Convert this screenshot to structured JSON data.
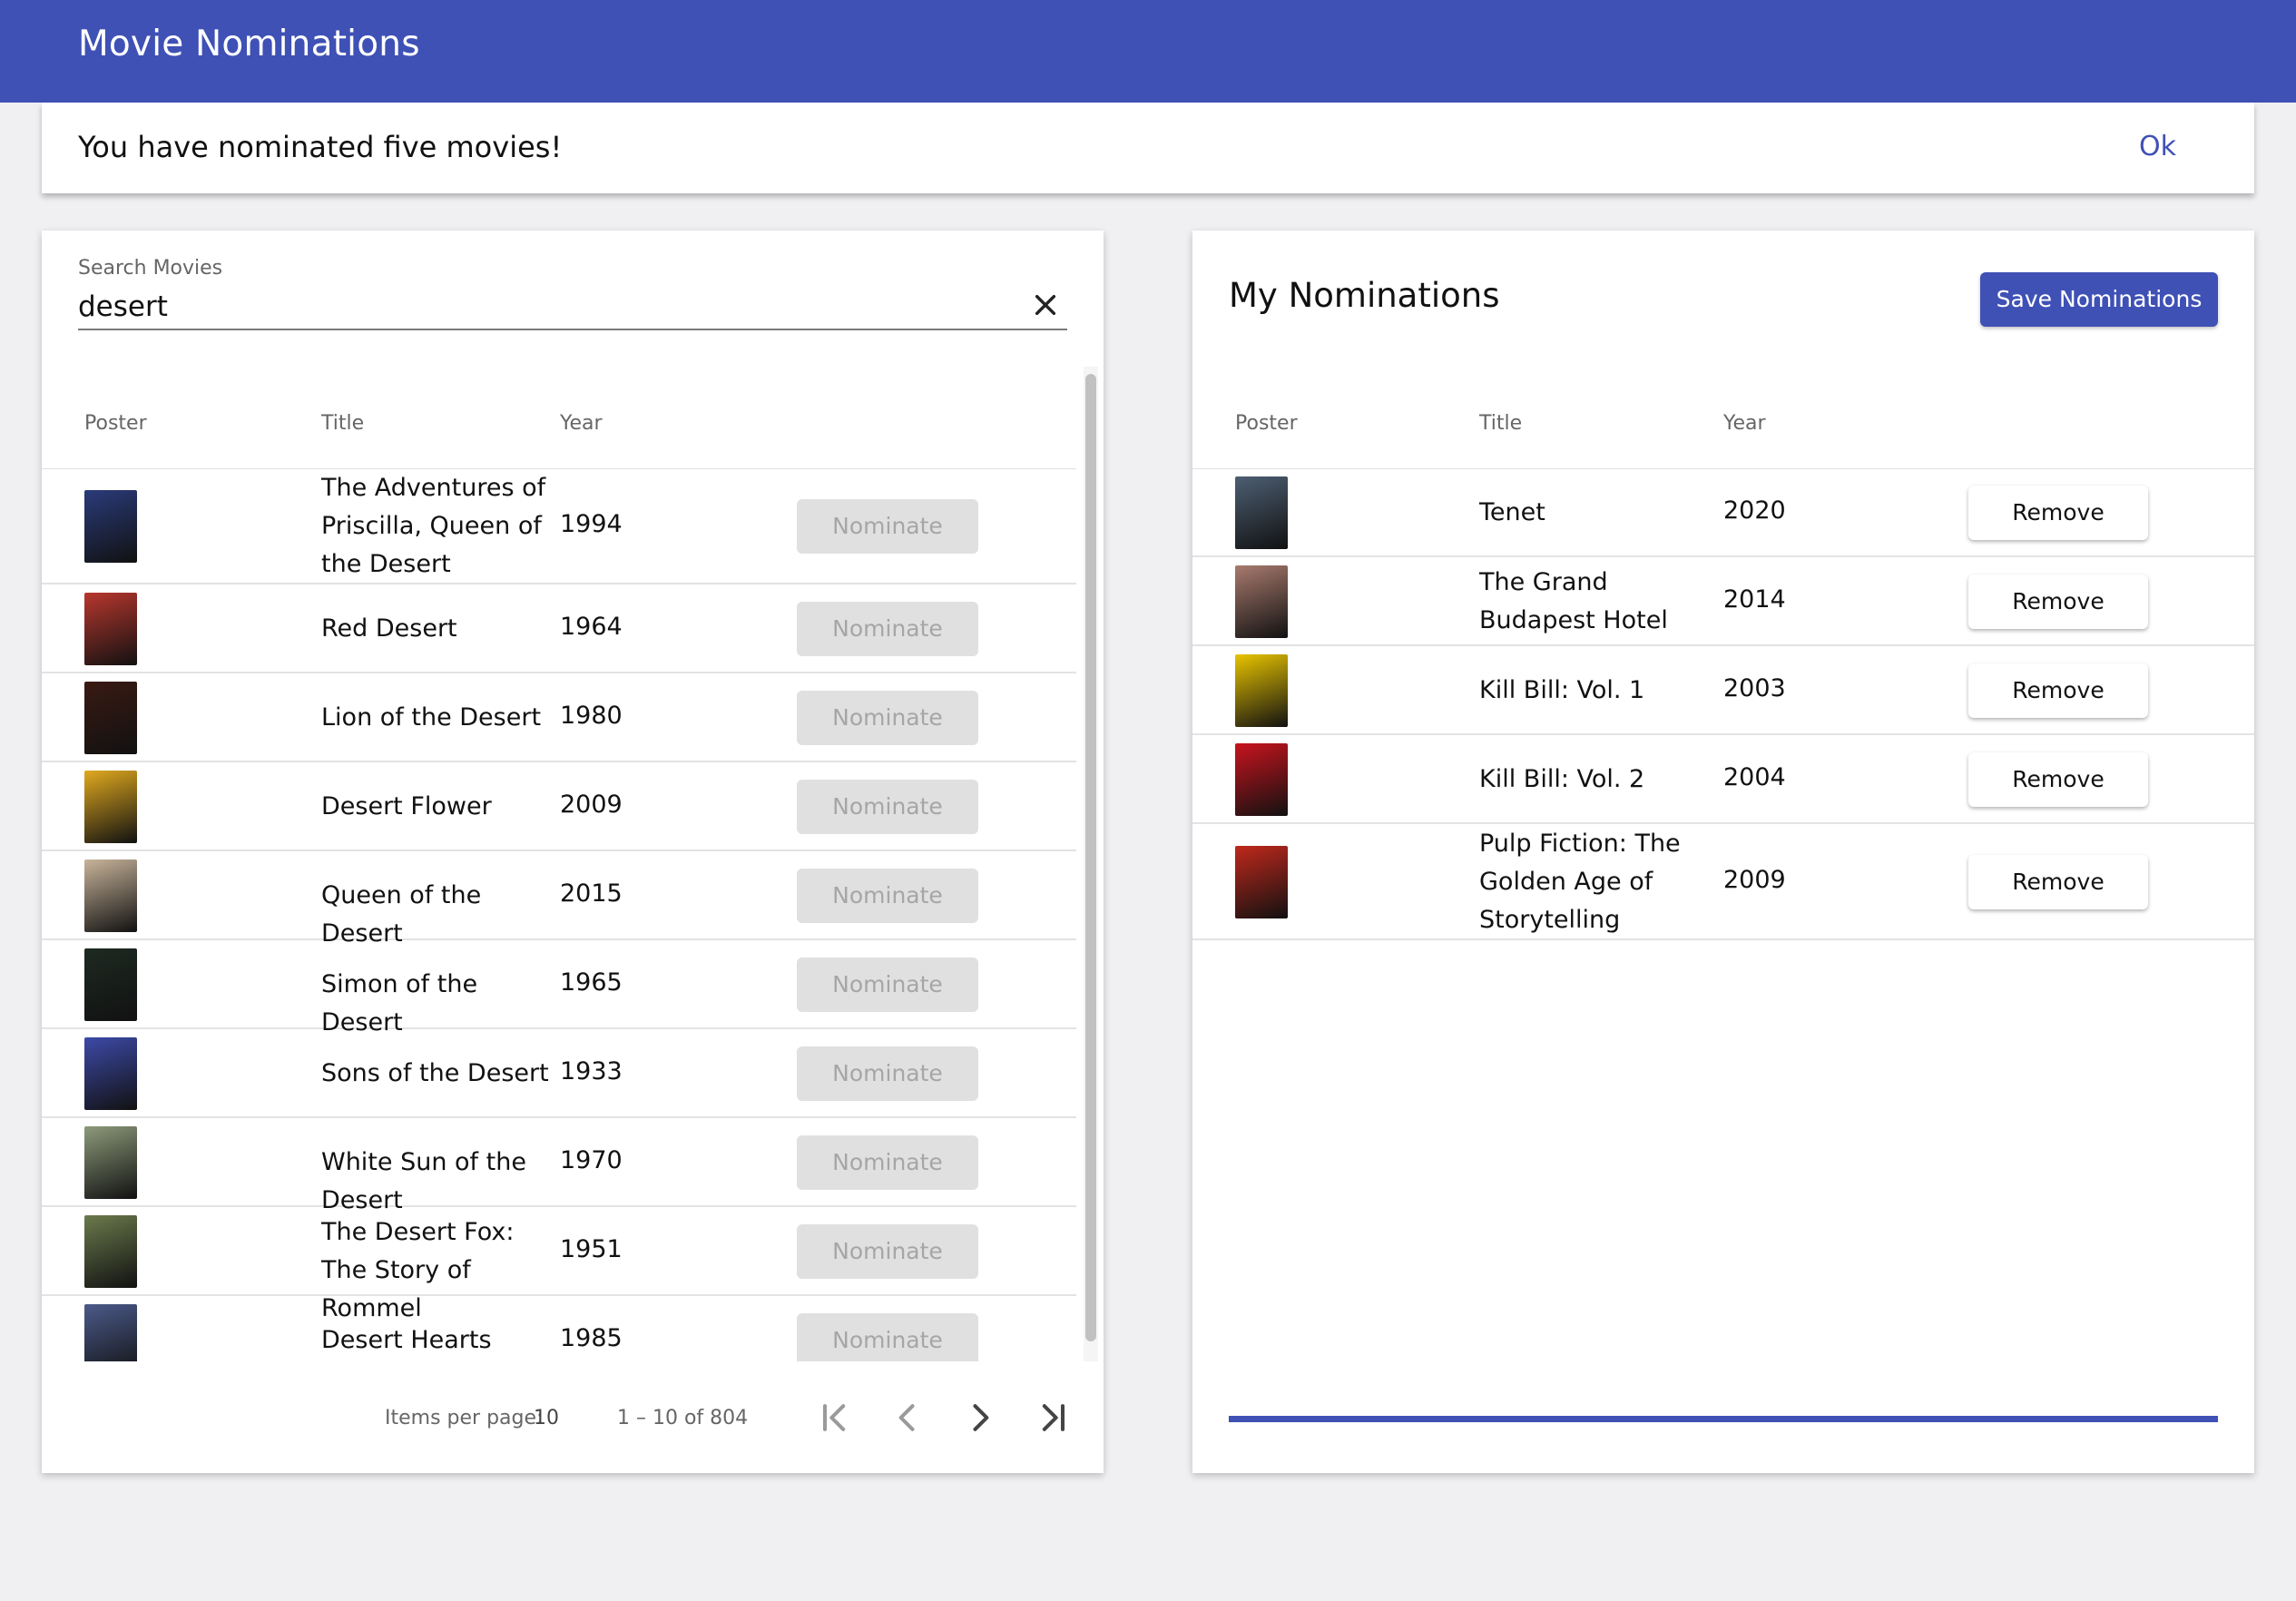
{
  "app": {
    "title": "Movie Nominations"
  },
  "banner": {
    "message": "You have nominated five movies!",
    "ok_label": "Ok"
  },
  "search": {
    "label": "Search Movies",
    "value": "desert"
  },
  "results": {
    "columns": {
      "poster": "Poster",
      "title": "Title",
      "year": "Year"
    },
    "nominate_label": "Nominate",
    "rows": [
      {
        "title": "The Adventures of Priscilla, Queen of the Desert",
        "year": "1994",
        "poster_color": "#2a3b7a"
      },
      {
        "title": "Red Desert",
        "year": "1964",
        "poster_color": "#b8372e"
      },
      {
        "title": "Lion of the Desert",
        "year": "1980",
        "poster_color": "#3a1a12"
      },
      {
        "title": "Desert Flower",
        "year": "2009",
        "poster_color": "#e0a91f"
      },
      {
        "title": "Queen of the Desert",
        "year": "2015",
        "poster_color": "#c8b49a"
      },
      {
        "title": "Simon of the Desert",
        "year": "1965",
        "poster_color": "#1e2a22"
      },
      {
        "title": "Sons of the Desert",
        "year": "1933",
        "poster_color": "#3d4aa8"
      },
      {
        "title": "White Sun of the Desert",
        "year": "1970",
        "poster_color": "#8d9a7a"
      },
      {
        "title": "The Desert Fox: The Story of Rommel",
        "year": "1951",
        "poster_color": "#6b7a4c"
      },
      {
        "title": "Desert Hearts",
        "year": "1985",
        "poster_color": "#4b5a8a"
      }
    ]
  },
  "paginator": {
    "items_per_page_label": "Items per page:",
    "items_per_page": "10",
    "range": "1 – 10 of 804"
  },
  "nominations": {
    "title": "My Nominations",
    "save_label": "Save Nominations",
    "columns": {
      "poster": "Poster",
      "title": "Title",
      "year": "Year"
    },
    "remove_label": "Remove",
    "progress": 1.0,
    "rows": [
      {
        "title": "Tenet",
        "year": "2020",
        "poster_color": "#4d5f73"
      },
      {
        "title": "The Grand Budapest Hotel",
        "year": "2014",
        "poster_color": "#a87a6e"
      },
      {
        "title": "Kill Bill: Vol. 1",
        "year": "2003",
        "poster_color": "#e8c400"
      },
      {
        "title": "Kill Bill: Vol. 2",
        "year": "2004",
        "poster_color": "#c8141e"
      },
      {
        "title": "Pulp Fiction: The Golden Age of Storytelling",
        "year": "2009",
        "poster_color": "#c0281c"
      }
    ]
  }
}
